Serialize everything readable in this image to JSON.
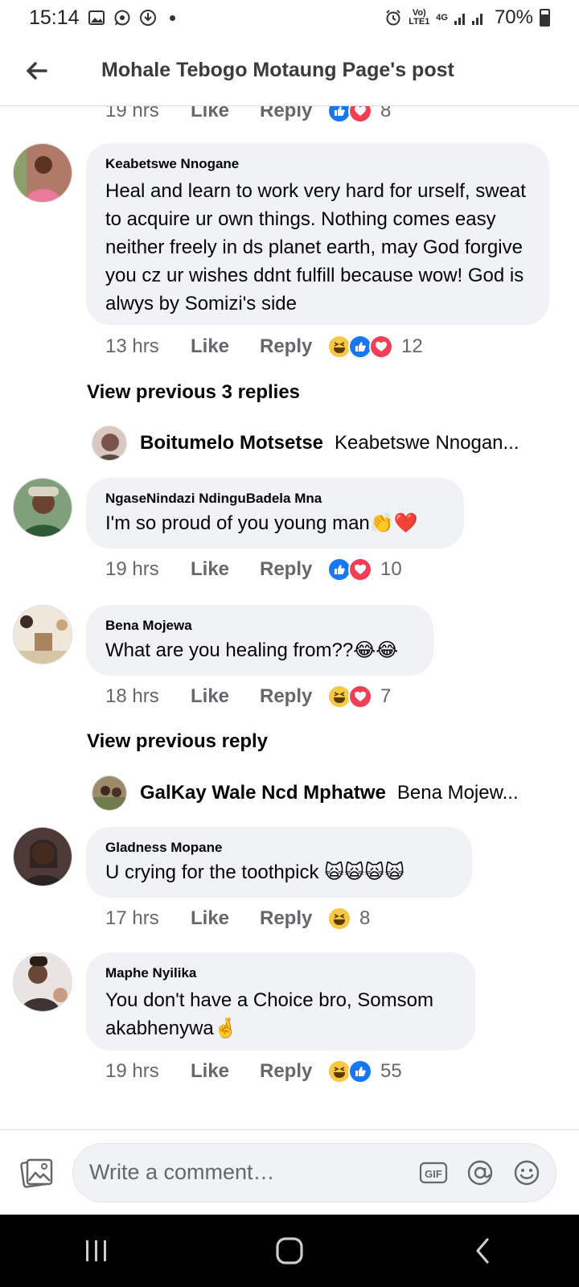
{
  "status_bar": {
    "time": "15:14",
    "network_label": "Vo) LTE1",
    "network_gen": "4G",
    "battery": "70%"
  },
  "header": {
    "title": "Mohale Tebogo Motaung Page's post"
  },
  "top_meta": {
    "time": "19 hrs",
    "like": "Like",
    "reply": "Reply",
    "count": "8"
  },
  "comments": [
    {
      "name": "Keabetswe Nnogane",
      "text": "Heal and learn to work very hard for urself, sweat to acquire ur own things. Nothing comes easy neither freely in ds planet earth, may God forgive you cz ur wishes ddnt fulfill because wow! God is alwys by Somizi's side",
      "time": "13 hrs",
      "like": "Like",
      "reply": "Reply",
      "count": "12"
    },
    {
      "name": "NgaseNindazi NdinguBadela Mna",
      "text": "I'm so proud of you young man👏❤️",
      "time": "19 hrs",
      "like": "Like",
      "reply": "Reply",
      "count": "10"
    },
    {
      "name": "Bena Mojewa",
      "text": "What are you healing from??😂😂",
      "time": "18 hrs",
      "like": "Like",
      "reply": "Reply",
      "count": "7"
    },
    {
      "name": "Gladness Mopane",
      "text": "U crying for the toothpick 🙀🙀🙀🙀",
      "time": "17 hrs",
      "like": "Like",
      "reply": "Reply",
      "count": "8"
    },
    {
      "name": "Maphe Nyilika",
      "text": "You don't have a Choice bro, Somsom akabhenywa🤞",
      "time": "19 hrs",
      "like": "Like",
      "reply": "Reply",
      "count": "55"
    }
  ],
  "view_previous": [
    {
      "label": "View previous 3 replies"
    },
    {
      "label": "View previous reply"
    }
  ],
  "reply_previews": [
    {
      "name": "Boitumelo Motsetse",
      "text": "Keabetswe Nnogan..."
    },
    {
      "name": "GalKay Wale Ncd Mphatwe",
      "text": "Bena Mojew..."
    }
  ],
  "composer": {
    "placeholder": "Write a comment…",
    "gif_label": "GIF"
  },
  "colors": {
    "accent": "#1877f2",
    "love": "#f33e58",
    "haha": "#f7c843",
    "bubble": "#f0f2f5",
    "meta_text": "#65676b"
  },
  "icons": [
    "back-arrow-icon",
    "photo-icon",
    "gif-icon",
    "mention-icon",
    "emoji-icon",
    "like-reaction-icon",
    "love-reaction-icon",
    "haha-reaction-icon"
  ]
}
